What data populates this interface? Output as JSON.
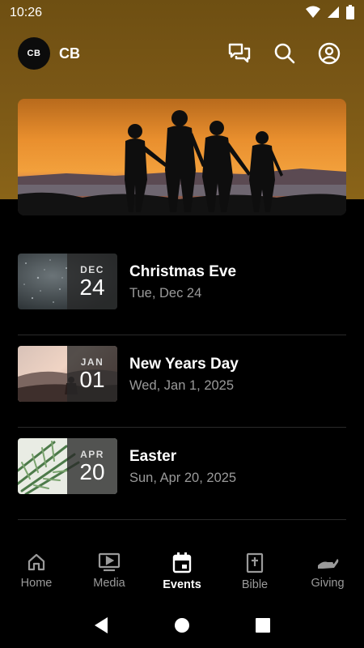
{
  "status_bar": {
    "time": "10:26"
  },
  "app": {
    "logo_text": "CB",
    "title": "CB"
  },
  "events": [
    {
      "month": "DEC",
      "day": "24",
      "title": "Christmas Eve",
      "subtitle": "Tue, Dec 24"
    },
    {
      "month": "JAN",
      "day": "01",
      "title": "New Years Day",
      "subtitle": "Wed, Jan 1, 2025"
    },
    {
      "month": "APR",
      "day": "20",
      "title": "Easter",
      "subtitle": "Sun, Apr 20, 2025"
    }
  ],
  "bottom_nav": [
    {
      "label": "Home",
      "icon": "home-icon",
      "active": false
    },
    {
      "label": "Media",
      "icon": "media-icon",
      "active": false
    },
    {
      "label": "Events",
      "icon": "calendar-icon",
      "active": true
    },
    {
      "label": "Bible",
      "icon": "bible-icon",
      "active": false
    },
    {
      "label": "Giving",
      "icon": "giving-icon",
      "active": false
    }
  ],
  "colors": {
    "header_gradient": "#7a5716",
    "background": "#000000",
    "muted_text": "#9a9a9a"
  }
}
